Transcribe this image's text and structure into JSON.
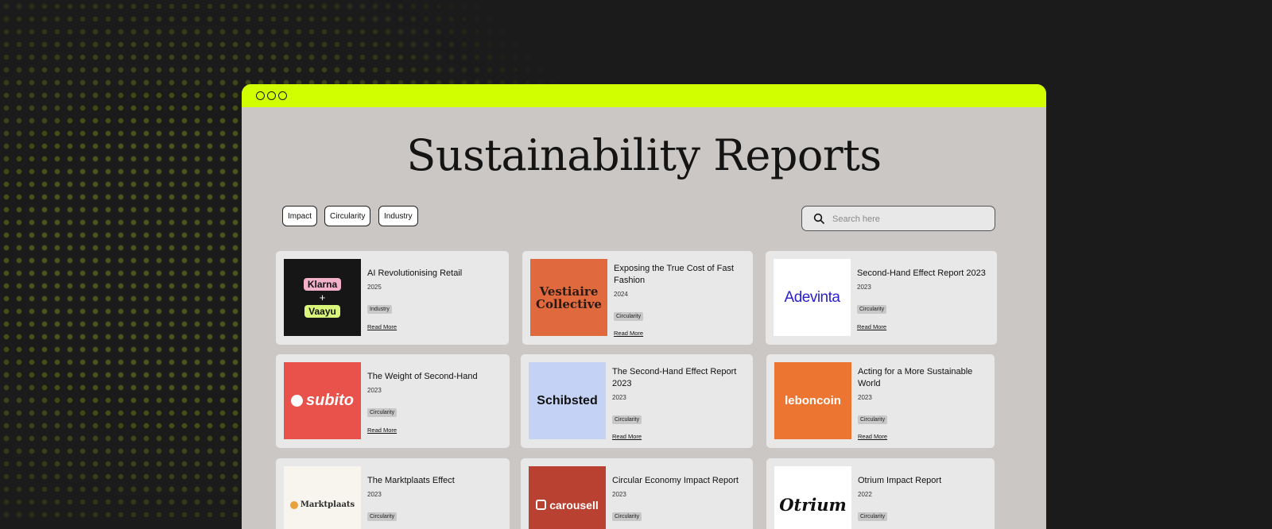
{
  "page_title": "Sustainability Reports",
  "filters": [
    "Impact",
    "Circularity",
    "Industry"
  ],
  "search": {
    "placeholder": "Search here"
  },
  "read_more_label": "Read More",
  "colors": {
    "accent": "#d2ff00",
    "background": "#1b1b1b",
    "window": "#cbc7c4",
    "card": "#e8e8e8"
  },
  "reports": [
    {
      "title": "AI Revolutionising Retail",
      "year": "2025",
      "tag": "Industry",
      "logo": {
        "lines": [
          "Klarna",
          "+",
          "Vaayu"
        ],
        "bg": "#161616"
      }
    },
    {
      "title": "Exposing the True Cost of Fast Fashion",
      "year": "2024",
      "tag": "Circularity",
      "logo": {
        "lines": [
          "Vestiaire",
          "Collective"
        ],
        "bg": "#e06a3e"
      }
    },
    {
      "title": "Second-Hand Effect Report 2023",
      "year": "2023",
      "tag": "Circularity",
      "logo": {
        "lines": [
          "Adevinta"
        ],
        "bg": "#ffffff"
      }
    },
    {
      "title": "The Weight of Second-Hand",
      "year": "2023",
      "tag": "Circularity",
      "logo": {
        "lines": [
          "subito"
        ],
        "bg": "#e8524a"
      }
    },
    {
      "title": "The Second-Hand Effect Report 2023",
      "year": "2023",
      "tag": "Circularity",
      "logo": {
        "lines": [
          "Schibsted"
        ],
        "bg": "#c4d3f5"
      }
    },
    {
      "title": "Acting for a More Sustainable World",
      "year": "2023",
      "tag": "Circularity",
      "logo": {
        "lines": [
          "leboncoin"
        ],
        "bg": "#ec7532"
      }
    },
    {
      "title": "The Marktplaats Effect",
      "year": "2023",
      "tag": "Circularity",
      "logo": {
        "lines": [
          "Marktplaats"
        ],
        "bg": "#f8f5ef"
      }
    },
    {
      "title": "Circular Economy Impact Report",
      "year": "2023",
      "tag": "Circularity",
      "logo": {
        "lines": [
          "carousell"
        ],
        "bg": "#b84132"
      }
    },
    {
      "title": "Otrium Impact Report",
      "year": "2022",
      "tag": "Circularity",
      "logo": {
        "lines": [
          "Otrium"
        ],
        "bg": "#ffffff"
      }
    }
  ]
}
